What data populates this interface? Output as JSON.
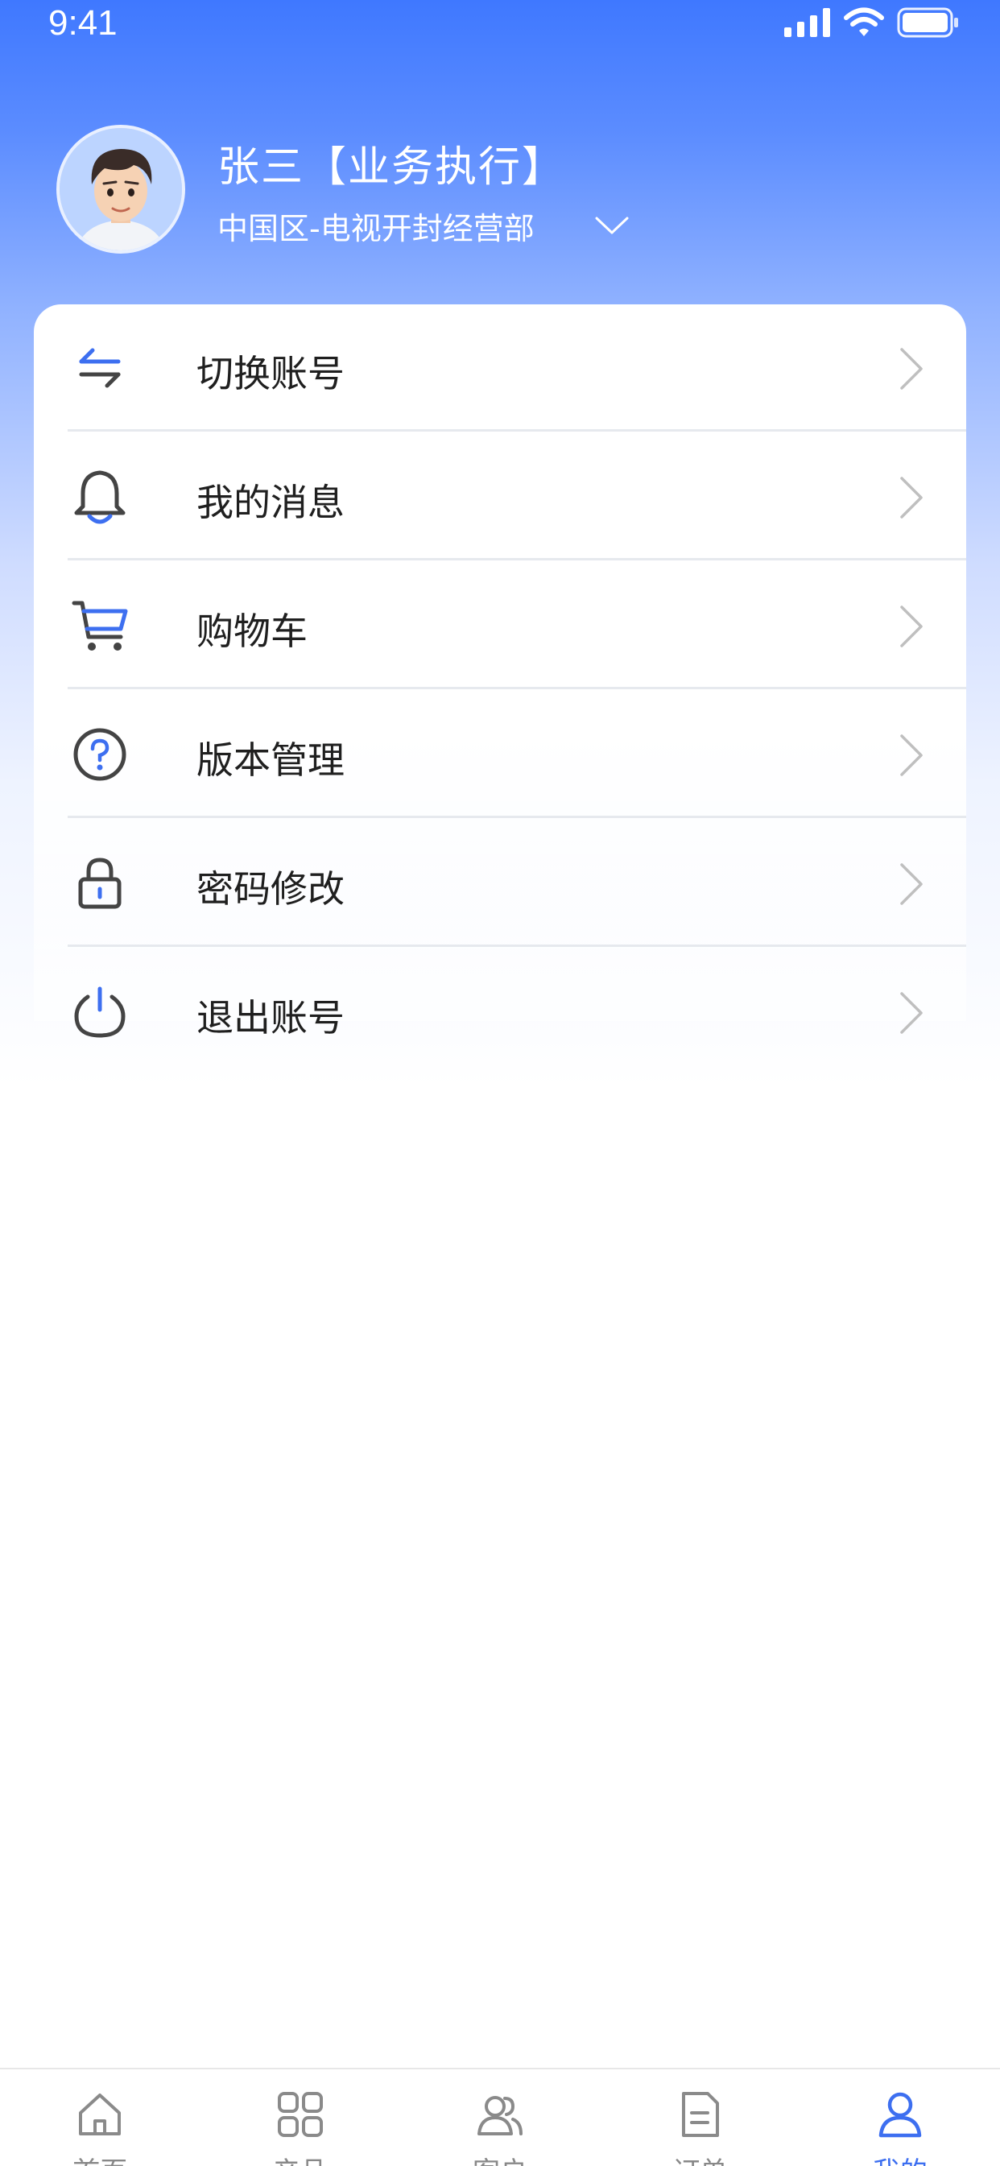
{
  "status_bar": {
    "time": "9:41"
  },
  "profile": {
    "name": "张三【业务执行】",
    "department": "中国区-电视开封经营部"
  },
  "menu": {
    "items": [
      {
        "label": "切换账号",
        "icon": "swap-arrows-icon"
      },
      {
        "label": "我的消息",
        "icon": "bell-icon"
      },
      {
        "label": "购物车",
        "icon": "cart-icon"
      },
      {
        "label": "版本管理",
        "icon": "help-circle-icon"
      },
      {
        "label": "密码修改",
        "icon": "lock-icon"
      },
      {
        "label": "退出账号",
        "icon": "power-icon"
      }
    ]
  },
  "tabs": [
    {
      "label": "首页",
      "icon": "home-icon",
      "active": false
    },
    {
      "label": "产品",
      "icon": "grid-icon",
      "active": false
    },
    {
      "label": "客户",
      "icon": "users-icon",
      "active": false
    },
    {
      "label": "订单",
      "icon": "document-icon",
      "active": false
    },
    {
      "label": "我的",
      "icon": "user-icon",
      "active": true
    }
  ],
  "colors": {
    "accent": "#3d6ff0",
    "header_top": "#3f78ff",
    "icon_stroke": "#444444",
    "chevron": "#bfbfbf",
    "divider": "#e6e9ee"
  }
}
